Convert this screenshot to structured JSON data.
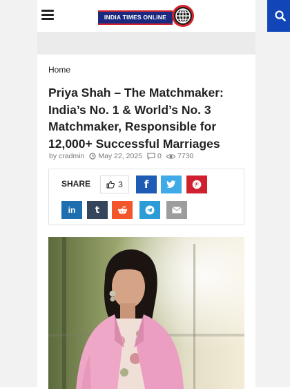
{
  "header": {
    "logo_text": "INDIA TIMES ONLINE",
    "icons": {
      "menu": "menu-icon",
      "search": "search-icon",
      "globe": "globe-icon"
    },
    "colors": {
      "logo_bg": "#1b2a80",
      "logo_accent": "#d4232b",
      "search_bg": "#1246b8"
    }
  },
  "breadcrumb": {
    "home": "Home"
  },
  "article": {
    "title": "Priya Shah – The Matchmaker: India’s No. 1 & World’s No. 3 Matchmaker, Responsible for 12,000+ Successful Marriages",
    "author_prefix": "by",
    "author": "cradmin",
    "date": "May 22, 2025",
    "comments": "0",
    "views": "7730"
  },
  "share": {
    "label": "SHARE",
    "likes": "3",
    "buttons": [
      {
        "name": "facebook",
        "glyph": "f",
        "color": "#1e5bb5"
      },
      {
        "name": "twitter",
        "glyph": "twitter-bird",
        "color": "#40a9e8"
      },
      {
        "name": "pinterest",
        "glyph": "P",
        "color": "#d0202f"
      },
      {
        "name": "linkedin",
        "glyph": "in",
        "color": "#1d6fb0"
      },
      {
        "name": "tumblr",
        "glyph": "t",
        "color": "#35465c"
      },
      {
        "name": "reddit",
        "glyph": "reddit-alien",
        "color": "#f2562a"
      },
      {
        "name": "telegram",
        "glyph": "paper-plane",
        "color": "#2b9cd8"
      },
      {
        "name": "email",
        "glyph": "envelope",
        "color": "#9d9d9d"
      }
    ]
  },
  "image": {
    "subject": "woman in pink blazer portrait"
  }
}
